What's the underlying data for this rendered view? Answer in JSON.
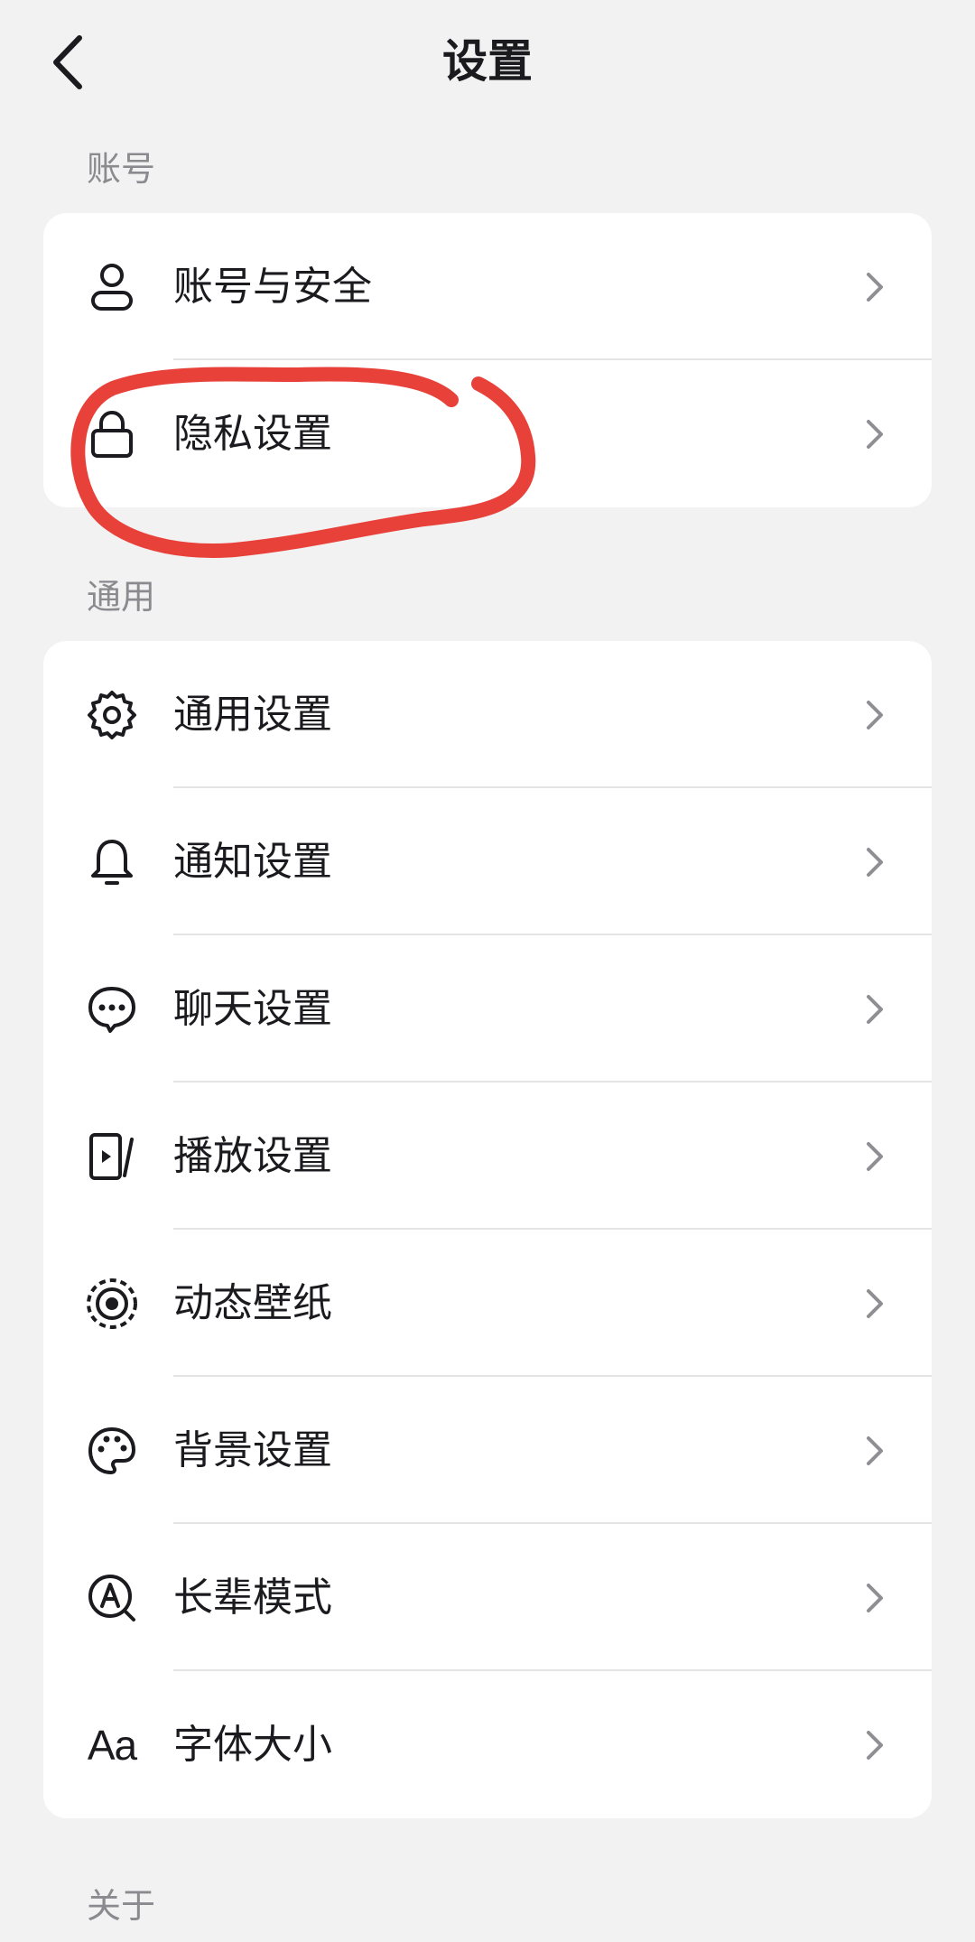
{
  "header": {
    "title": "设置",
    "back_icon": "chevron-left-icon"
  },
  "sections": {
    "account": {
      "label": "账号",
      "items": [
        {
          "label": "账号与安全",
          "icon": "user-icon"
        },
        {
          "label": "隐私设置",
          "icon": "lock-icon"
        }
      ]
    },
    "general": {
      "label": "通用",
      "items": [
        {
          "label": "通用设置",
          "icon": "gear-icon"
        },
        {
          "label": "通知设置",
          "icon": "bell-icon"
        },
        {
          "label": "聊天设置",
          "icon": "chat-bubble-icon"
        },
        {
          "label": "播放设置",
          "icon": "play-screen-icon"
        },
        {
          "label": "动态壁纸",
          "icon": "dynamic-wallpaper-icon"
        },
        {
          "label": "背景设置",
          "icon": "palette-icon"
        },
        {
          "label": "长辈模式",
          "icon": "elder-mode-icon"
        },
        {
          "label": "字体大小",
          "icon": "font-size-icon",
          "icon_text": "Aa"
        }
      ]
    },
    "about": {
      "label": "关于"
    }
  },
  "colors": {
    "background": "#f2f2f2",
    "card": "#ffffff",
    "text": "#1b1b1f",
    "secondary_text": "#8a8a8f",
    "chevron": "#8e8e93",
    "annotation_circle": "#e8413a"
  }
}
